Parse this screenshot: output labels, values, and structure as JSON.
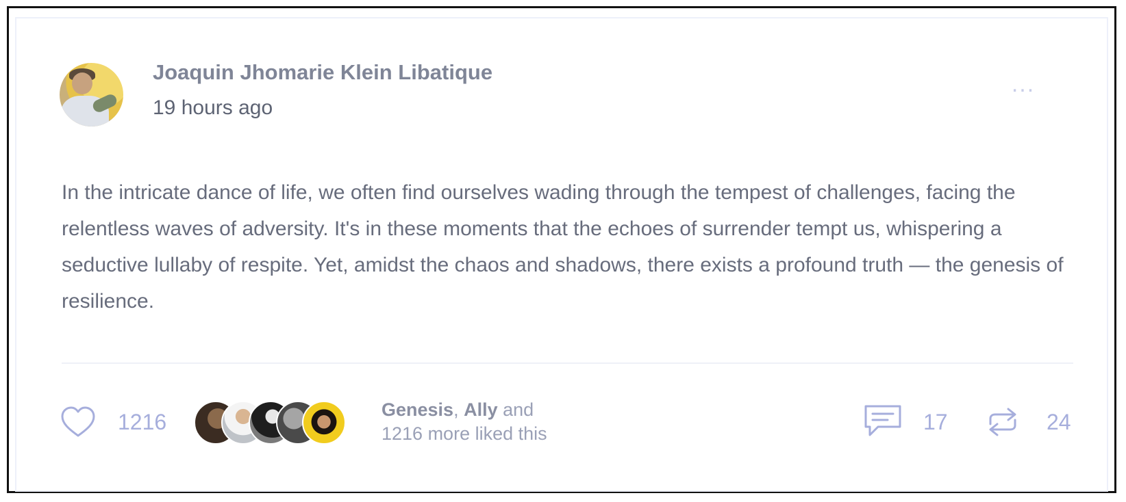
{
  "post": {
    "author": "Joaquin Jhomarie Klein Libatique",
    "timestamp": "19 hours ago",
    "menu_label": "...",
    "body": "In the intricate dance of life, we often find ourselves wading through the tempest of challenges, facing the relentless waves of adversity. It's in these moments that the echoes of surrender tempt us, whispering a seductive lullaby of respite. Yet, amidst the chaos and shadows, there exists a profound truth — the genesis of resilience."
  },
  "reactions": {
    "like_count": "1216",
    "liked_by_first": "Genesis",
    "liked_by_separator": ", ",
    "liked_by_second": "Ally",
    "liked_by_suffix": " and",
    "liked_more": "1216 more liked this",
    "comment_count": "17",
    "share_count": "24"
  },
  "icons": {
    "like": "heart-outline-icon",
    "comment": "comment-icon",
    "share": "repost-arrows-icon",
    "menu": "more-horizontal-icon"
  },
  "colors": {
    "accent": "#a6aedc",
    "author_text": "#7f8597",
    "body_text": "#676c7c"
  }
}
